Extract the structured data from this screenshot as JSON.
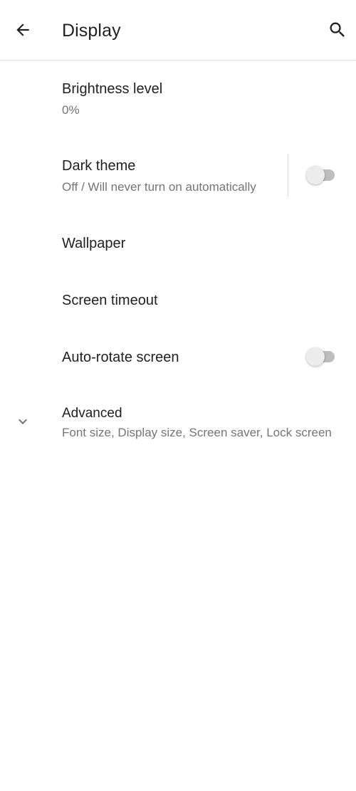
{
  "app_bar": {
    "title": "Display",
    "back_icon": "arrow-back-icon",
    "search_icon": "search-icon"
  },
  "settings": {
    "brightness": {
      "title": "Brightness level",
      "summary": "0%"
    },
    "dark_theme": {
      "title": "Dark theme",
      "summary": "Off / Will never turn on automatically",
      "enabled": false
    },
    "wallpaper": {
      "title": "Wallpaper"
    },
    "screen_timeout": {
      "title": "Screen timeout"
    },
    "auto_rotate": {
      "title": "Auto-rotate screen",
      "enabled": false
    },
    "advanced": {
      "title": "Advanced",
      "summary": "Font size, Display size, Screen saver, Lock screen",
      "icon": "chevron-down-icon"
    }
  },
  "colors": {
    "background": "#ffffff",
    "text_primary": "#202124",
    "text_secondary": "#757575",
    "switch_track_off": "#bdbdbd",
    "switch_thumb_off": "#ececec"
  }
}
